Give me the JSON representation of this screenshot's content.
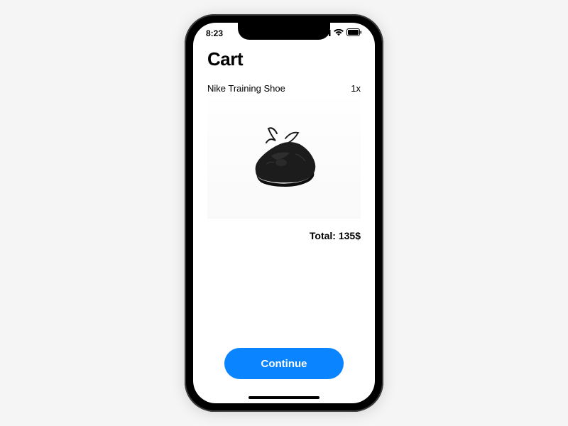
{
  "statusbar": {
    "time": "8:23"
  },
  "page": {
    "title": "Cart"
  },
  "item": {
    "name": "Nike Training Shoe",
    "quantity": "1x"
  },
  "total": {
    "label": "Total: 135$"
  },
  "actions": {
    "continue_label": "Continue"
  },
  "icons": {
    "signal": "signal-icon",
    "wifi": "wifi-icon",
    "battery": "battery-icon"
  },
  "colors": {
    "primary": "#0a84ff"
  }
}
